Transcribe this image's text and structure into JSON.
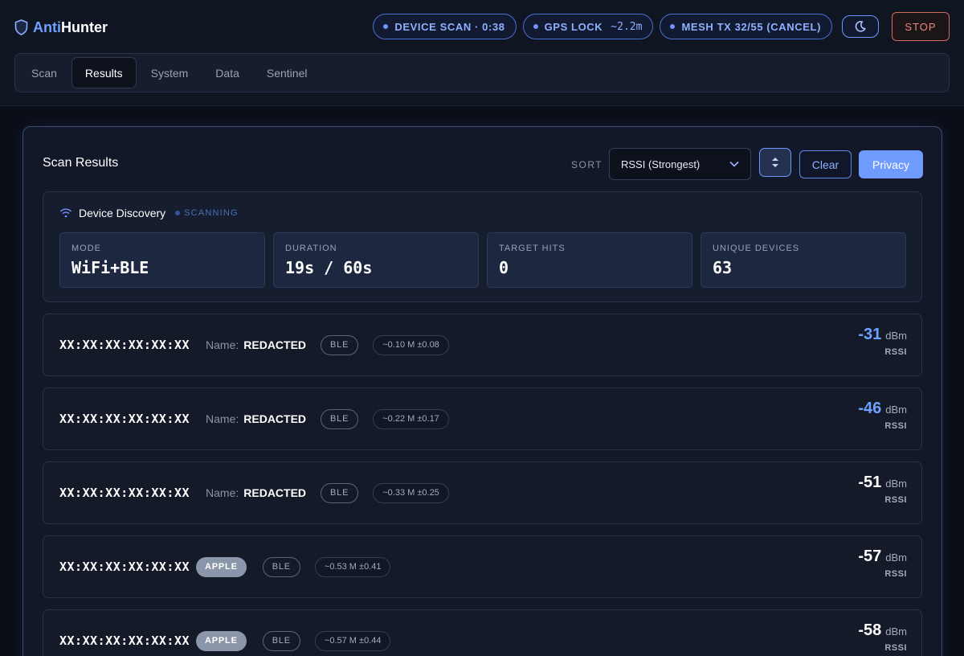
{
  "brand": {
    "prefix": "Anti",
    "suffix": "Hunter"
  },
  "status_pills": {
    "device_scan": "DEVICE SCAN · 0:38",
    "gps_lock_label": "GPS LOCK",
    "gps_lock_value": "~2.2m",
    "mesh_tx": "MESH TX 32/55 (CANCEL)"
  },
  "stop_label": "STOP",
  "tabs": [
    {
      "label": "Scan"
    },
    {
      "label": "Results"
    },
    {
      "label": "System"
    },
    {
      "label": "Data"
    },
    {
      "label": "Sentinel"
    }
  ],
  "active_tab": "Results",
  "results": {
    "title": "Scan Results",
    "sort_label": "SORT",
    "sort_value": "RSSI (Strongest)",
    "clear_label": "Clear",
    "privacy_label": "Privacy"
  },
  "discovery": {
    "title": "Device Discovery",
    "status": "SCANNING",
    "stats": [
      {
        "label": "MODE",
        "value": "WiFi+BLE"
      },
      {
        "label": "DURATION",
        "value": "19s / 60s"
      },
      {
        "label": "TARGET HITS",
        "value": "0"
      },
      {
        "label": "UNIQUE DEVICES",
        "value": "63"
      }
    ]
  },
  "device_name_label": "Name:",
  "rssi_unit": "dBm",
  "rssi_caption": "RSSI",
  "devices": [
    {
      "mac": "XX:XX:XX:XX:XX:XX",
      "name": "REDACTED",
      "vendor": "",
      "type": "BLE",
      "distance": "~0.10 M ±0.08",
      "rssi": "-31"
    },
    {
      "mac": "XX:XX:XX:XX:XX:XX",
      "name": "REDACTED",
      "vendor": "",
      "type": "BLE",
      "distance": "~0.22 M ±0.17",
      "rssi": "-46"
    },
    {
      "mac": "XX:XX:XX:XX:XX:XX",
      "name": "REDACTED",
      "vendor": "",
      "type": "BLE",
      "distance": "~0.33 M ±0.25",
      "rssi": "-51"
    },
    {
      "mac": "XX:XX:XX:XX:XX:XX",
      "name": "",
      "vendor": "APPLE",
      "type": "BLE",
      "distance": "~0.53 M ±0.41",
      "rssi": "-57"
    },
    {
      "mac": "XX:XX:XX:XX:XX:XX",
      "name": "",
      "vendor": "APPLE",
      "type": "BLE",
      "distance": "~0.57 M ±0.44",
      "rssi": "-58"
    }
  ],
  "colors": {
    "accent": "#6ea1ff",
    "stop": "#e98a7b",
    "background": "#0a0e17"
  }
}
